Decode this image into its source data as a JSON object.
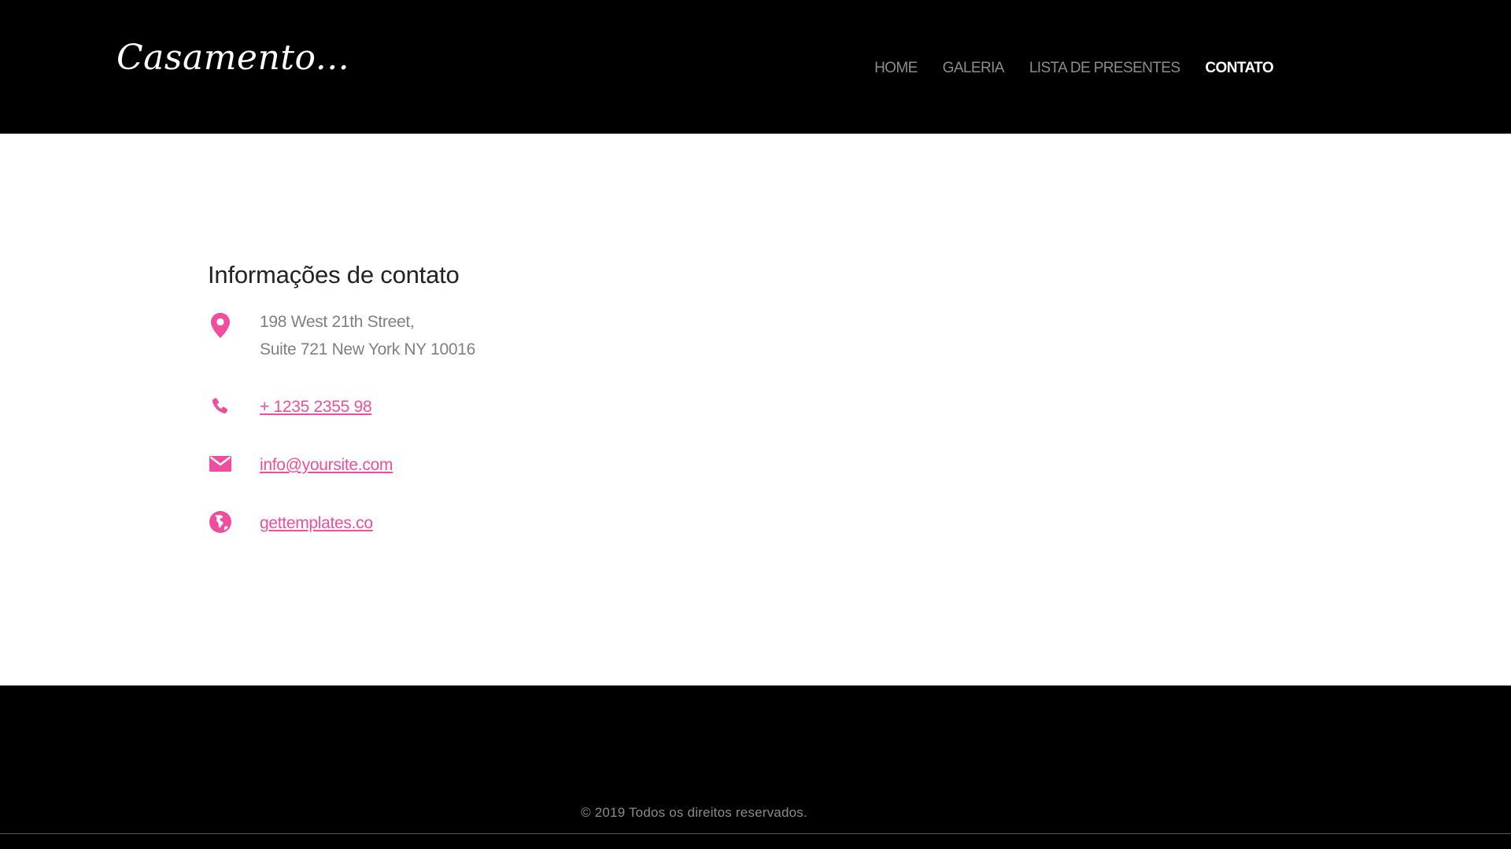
{
  "header": {
    "brand": "Casamento...",
    "nav": [
      {
        "label": "HOME",
        "active": false
      },
      {
        "label": "GALERIA",
        "active": false
      },
      {
        "label": "LISTA DE PRESENTES",
        "active": false
      },
      {
        "label": "CONTATO",
        "active": true
      }
    ]
  },
  "contact": {
    "heading": "Informações de contato",
    "address_line1": "198 West 21th Street,",
    "address_line2": "Suite 721 New York NY 10016",
    "phone": "+ 1235 2355 98",
    "email": "info@yoursite.com",
    "website": "gettemplates.co",
    "icons": {
      "address": "map-marker-icon",
      "phone": "phone-icon",
      "email": "envelope-icon",
      "website": "globe-icon"
    }
  },
  "footer": {
    "copyright": "© 2019 Todos os direitos reservados."
  },
  "colors": {
    "accent": "#ee4e9d",
    "header_bg": "#000000",
    "footer_bg": "#000000",
    "nav_inactive": "#8c8c8c",
    "nav_active": "#ffffff",
    "body_text": "#808080",
    "heading_text": "#222222"
  }
}
